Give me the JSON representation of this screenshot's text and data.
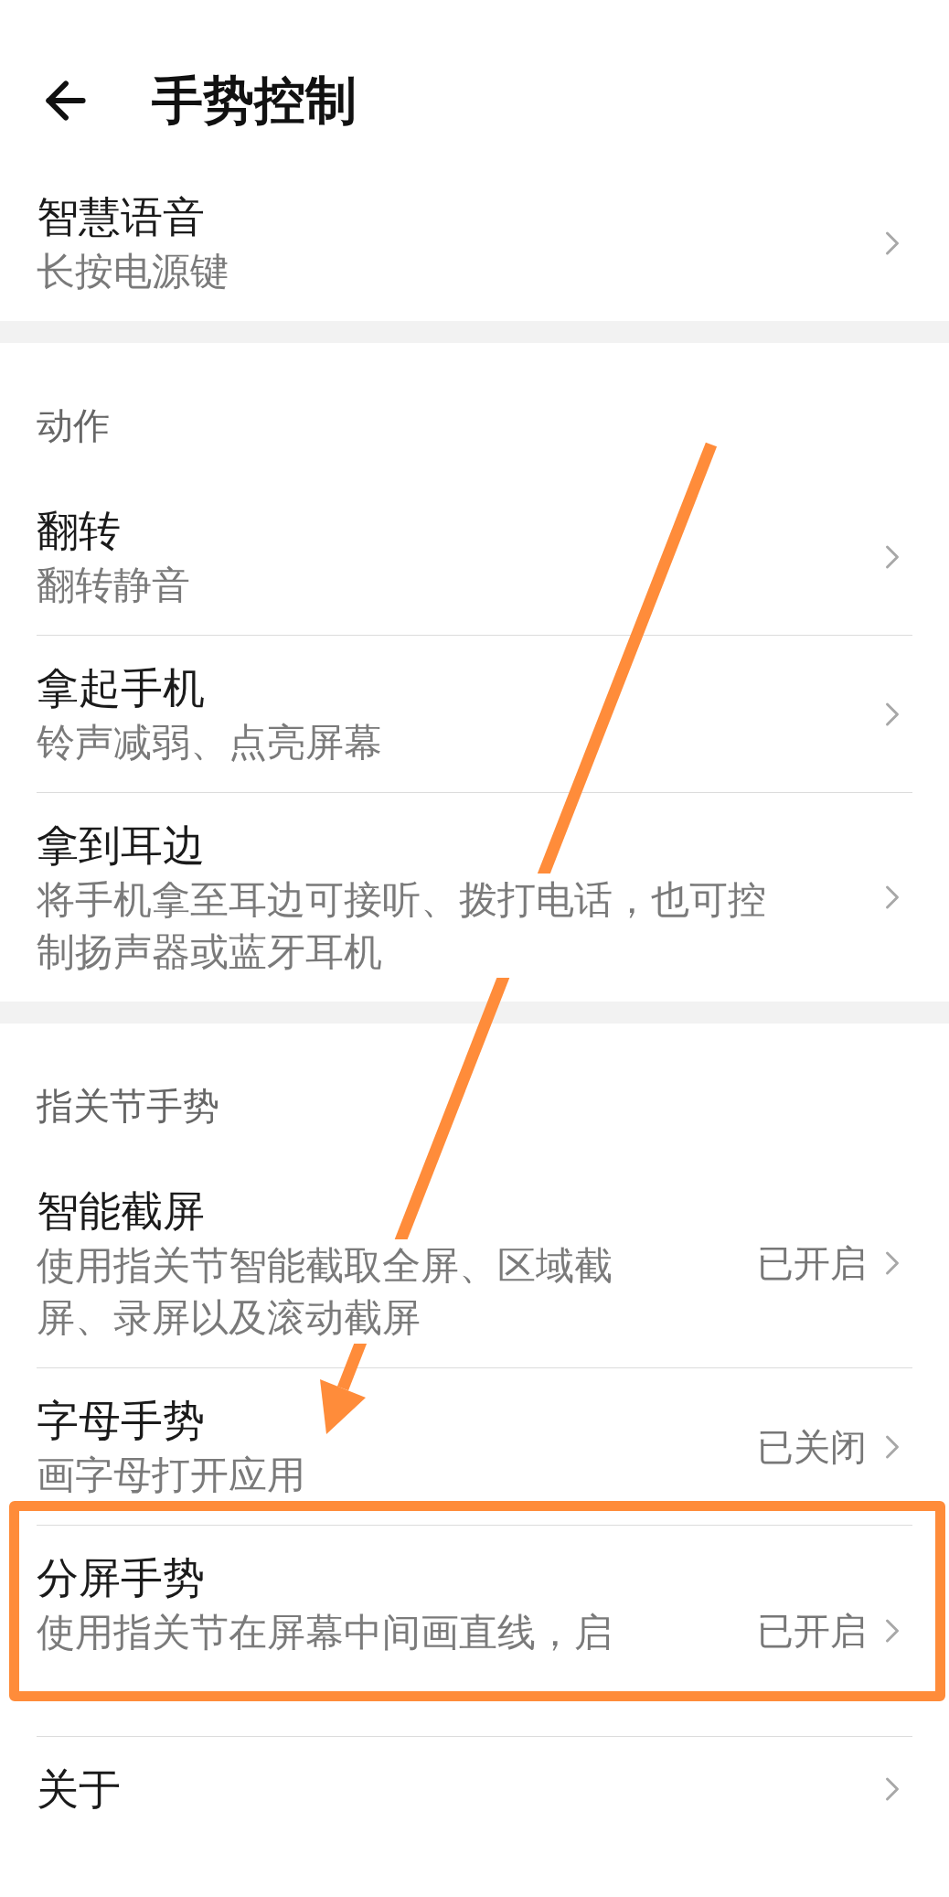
{
  "header": {
    "title": "手势控制"
  },
  "sections": [
    {
      "items": [
        {
          "title": "智慧语音",
          "subtitle": "长按电源键",
          "highlighted": false
        }
      ]
    },
    {
      "heading": "动作",
      "items": [
        {
          "title": "翻转",
          "subtitle": "翻转静音",
          "highlighted": false
        },
        {
          "title": "拿起手机",
          "subtitle": "铃声减弱、点亮屏幕",
          "highlighted": false
        },
        {
          "title": "拿到耳边",
          "subtitle": "将手机拿至耳边可接听、拨打电话，也可控制扬声器或蓝牙耳机",
          "highlighted": false
        }
      ]
    },
    {
      "heading": "指关节手势",
      "items": [
        {
          "title": "智能截屏",
          "subtitle": "使用指关节智能截取全屏、区域截屏、录屏以及滚动截屏",
          "status": "已开启",
          "highlighted": false
        },
        {
          "title": "字母手势",
          "subtitle": "画字母打开应用",
          "status": "已关闭",
          "highlighted": false
        },
        {
          "title": "分屏手势",
          "subtitle": "使用指关节在屏幕中间画直线，启",
          "status": "已开启",
          "highlighted": true
        },
        {
          "title": "关于",
          "highlighted": false
        }
      ]
    }
  ]
}
